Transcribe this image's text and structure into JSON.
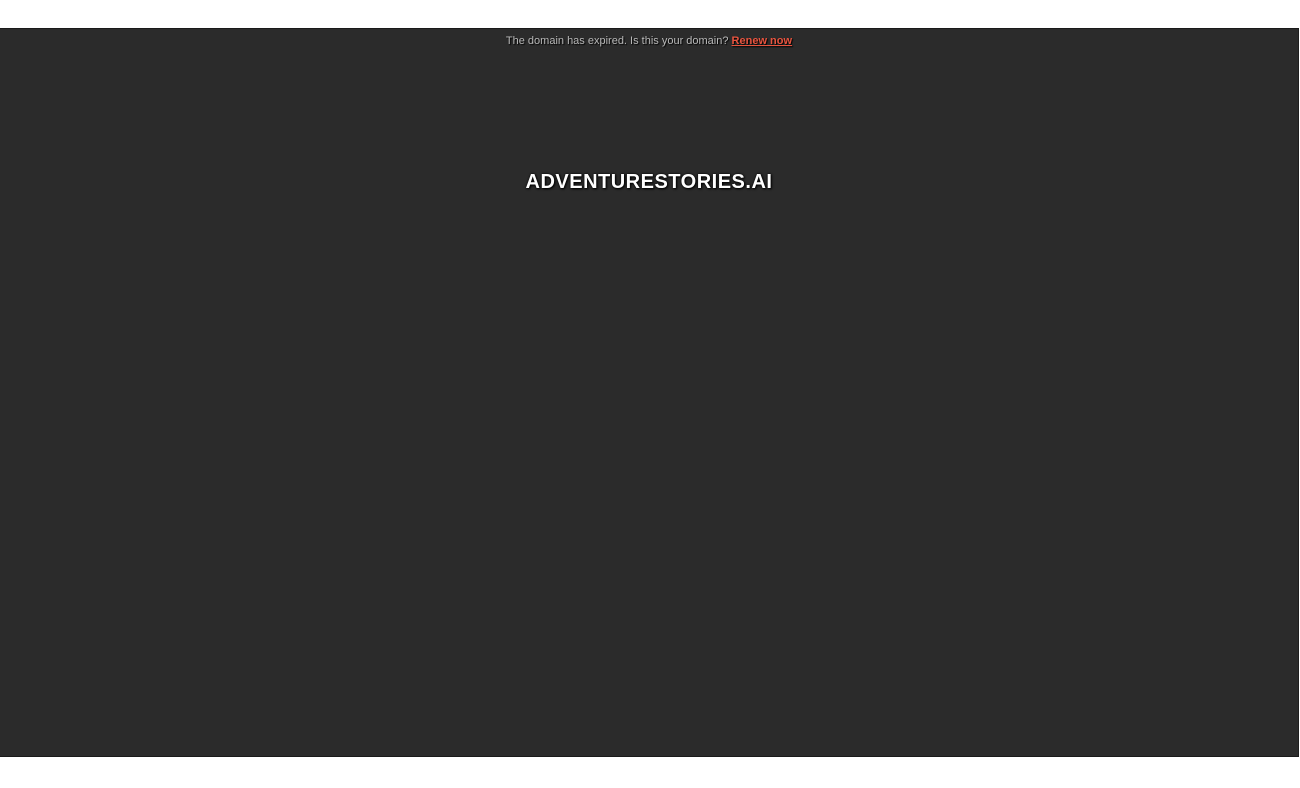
{
  "notice": {
    "message": "The domain has expired. Is this your domain?",
    "renew_label": "Renew now"
  },
  "domain": {
    "name": "ADVENTURESTORIES.AI"
  },
  "colors": {
    "background": "#2b2b2b",
    "notice_text": "#b9b9b9",
    "renew_link": "#e8543f",
    "title_text": "#ffffff"
  }
}
